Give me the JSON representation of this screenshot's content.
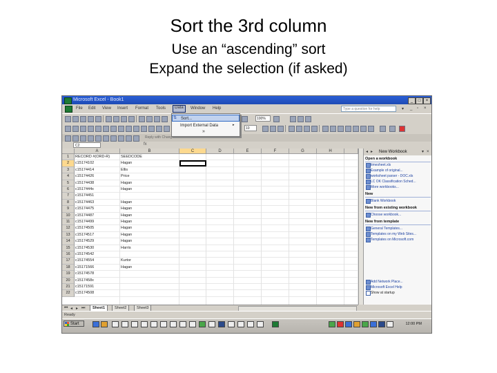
{
  "slide": {
    "title": "Sort the 3rd column",
    "line2": "Use an “ascending” sort",
    "line3": "Expand the selection (if asked)"
  },
  "window": {
    "title": "Microsoft Excel - Book1"
  },
  "menubar": {
    "items": [
      "File",
      "Edit",
      "View",
      "Insert",
      "Format",
      "Tools",
      "Data",
      "Window",
      "Help"
    ],
    "selected": "Data",
    "question_placeholder": "Type a question for help"
  },
  "toolbar": {
    "zoom": "100%",
    "font_size": "10",
    "extra_text": "Reply with Changes... End Review..."
  },
  "data_menu": {
    "items": [
      "Sort...",
      "Import External Data",
      "»"
    ],
    "highlighted": "Sort..."
  },
  "formula_bar": {
    "name_box": "C2",
    "fx": "fx"
  },
  "sheet": {
    "columns": [
      "A",
      "B",
      "C",
      "D",
      "E",
      "F",
      "G",
      "H"
    ],
    "selected_column": "C",
    "selected_row": "2",
    "rows": [
      {
        "n": "1",
        "a": "RECORD #(ORD-R)",
        "b": "SEEDCODE"
      },
      {
        "n": "2",
        "a": "c15174102",
        "b": "Hagan"
      },
      {
        "n": "3",
        "a": "c15174414",
        "b": "Ellis"
      },
      {
        "n": "4",
        "a": "c15174426",
        "b": "Price"
      },
      {
        "n": "5",
        "a": "c15174438",
        "b": "Hagan"
      },
      {
        "n": "6",
        "a": "c1517444x",
        "b": "Hagan"
      },
      {
        "n": "7",
        "a": "c15174451",
        "b": ""
      },
      {
        "n": "8",
        "a": "c15174463",
        "b": "Hagan"
      },
      {
        "n": "9",
        "a": "c15174475",
        "b": "Hagan"
      },
      {
        "n": "10",
        "a": "c15174487",
        "b": "Hagan"
      },
      {
        "n": "11",
        "a": "c15174499",
        "b": "Hagan"
      },
      {
        "n": "12",
        "a": "c15174505",
        "b": "Hagan"
      },
      {
        "n": "13",
        "a": "c15174517",
        "b": "Hagan"
      },
      {
        "n": "14",
        "a": "c15174529",
        "b": "Hagan"
      },
      {
        "n": "15",
        "a": "c15174530",
        "b": "Harris"
      },
      {
        "n": "16",
        "a": "c15174542",
        "b": ""
      },
      {
        "n": "17",
        "a": "c15174554",
        "b": "Kurtor"
      },
      {
        "n": "18",
        "a": "c15171566",
        "b": "Hagan"
      },
      {
        "n": "19",
        "a": "c15174578",
        "b": ""
      },
      {
        "n": "20",
        "a": "c1517458x",
        "b": ""
      },
      {
        "n": "21",
        "a": "c15171591",
        "b": ""
      },
      {
        "n": "22",
        "a": "c15174508",
        "b": ""
      }
    ],
    "tabs": [
      "Sheet1",
      "Sheet2",
      "Sheet3"
    ],
    "active_tab": "Sheet1"
  },
  "task_pane": {
    "title": "New Workbook",
    "sections": [
      {
        "heading": "Open a workbook",
        "links": [
          "timesheet.xls",
          "Example of original...",
          "worksheet parser - DOC.xls",
          "LC OK Classification Sched...",
          "More workbooks..."
        ]
      },
      {
        "heading": "New",
        "links": [
          "Blank Workbook"
        ]
      },
      {
        "heading": "New from existing workbook",
        "links": [
          "Choose workbook..."
        ]
      },
      {
        "heading": "New from template",
        "links": [
          "General Templates...",
          "Templates on my Web Sites...",
          "Templates on Microsoft.com"
        ]
      }
    ],
    "footer_links": [
      "Add Network Place...",
      "Microsoft Excel Help",
      "Show at startup"
    ]
  },
  "status": {
    "text": "Ready"
  },
  "taskbar": {
    "start_label": "Start",
    "clock": "12:00 PM"
  }
}
